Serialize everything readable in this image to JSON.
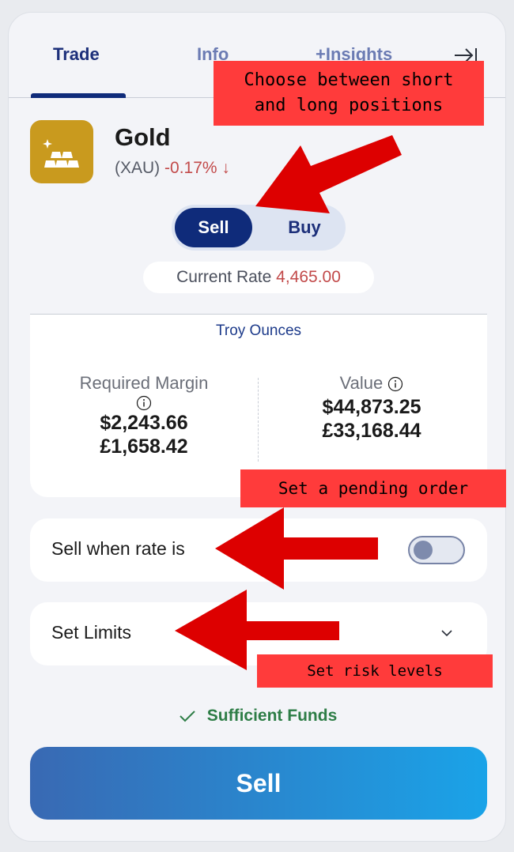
{
  "tabs": [
    {
      "label": "Trade",
      "active": true
    },
    {
      "label": "Info",
      "active": false
    },
    {
      "label": "+Insights",
      "active": false
    }
  ],
  "asset": {
    "name": "Gold",
    "symbol": "(XAU)",
    "change": "-0.17%",
    "change_direction": "down",
    "icon": "gold-bars-icon",
    "logo_color": "#c99a1e"
  },
  "direction": {
    "sell_label": "Sell",
    "buy_label": "Buy",
    "selected": "Sell"
  },
  "rate": {
    "label": "Current Rate",
    "value": "4,465.00"
  },
  "margin": {
    "units": "Troy Ounces",
    "required_label": "Required Margin",
    "required_usd": "$2,243.66",
    "required_gbp": "£1,658.42",
    "value_label": "Value",
    "value_usd": "$44,873.25",
    "value_gbp": "£33,168.44"
  },
  "pending": {
    "label": "Sell when rate is",
    "enabled": false
  },
  "limits": {
    "label": "Set Limits"
  },
  "funds": {
    "status": "Sufficient Funds"
  },
  "action": {
    "label": "Sell"
  },
  "annotations": {
    "note1_line1": "Choose between short",
    "note1_line2": "and long positions",
    "note2": "Set a pending order",
    "note3": "Set risk levels"
  },
  "colors": {
    "primary": "#0f2b7a",
    "negative": "#c24a4a",
    "positive": "#2d7d46",
    "annotation": "#ff3b3b"
  }
}
